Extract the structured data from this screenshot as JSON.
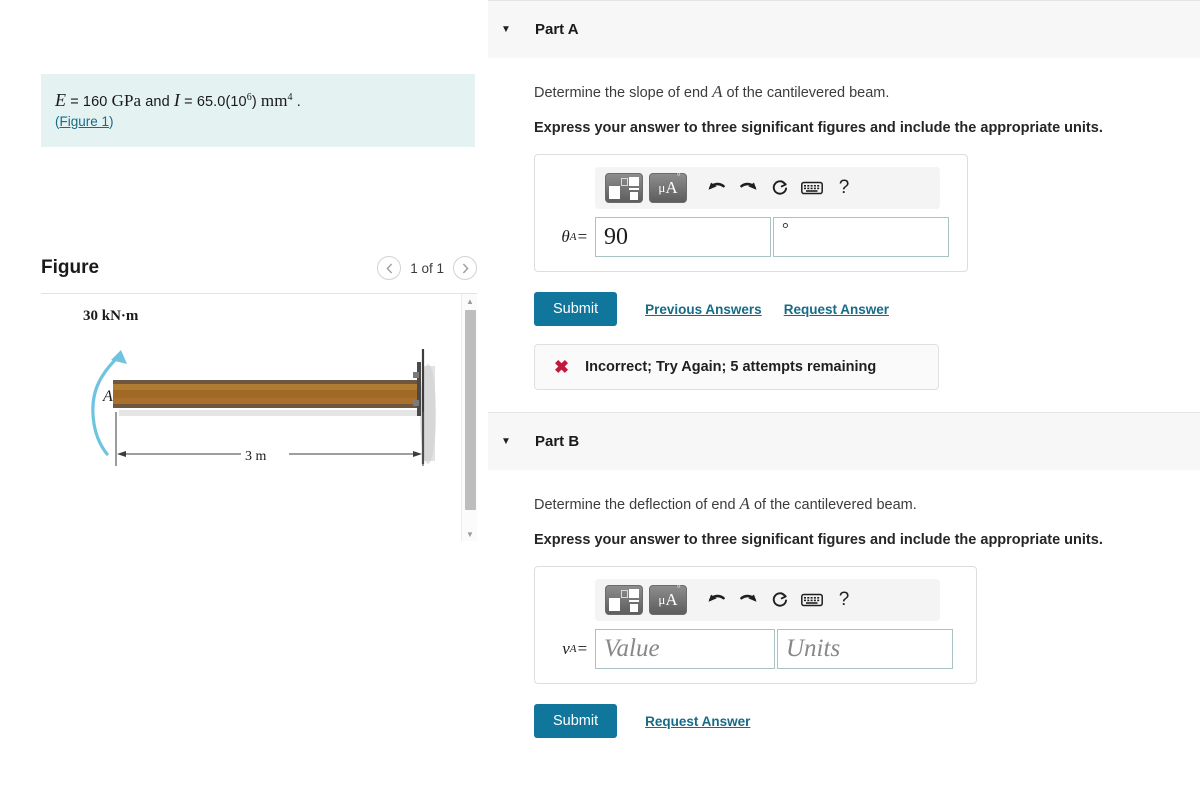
{
  "problem": {
    "statement_prefix": "E",
    "statement_eq1": " = 160  ",
    "statement_unit1": "GPa",
    "statement_and": " and ",
    "statement_I": "I",
    "statement_eq2": " = 65.0(10",
    "statement_exp": "6",
    "statement_close": ") ",
    "statement_unit2": "mm",
    "statement_exp2": "4",
    "statement_period": " .",
    "figure_link": "(Figure 1)",
    "figure_link_text": "Figure 1"
  },
  "figure_panel": {
    "title": "Figure",
    "prev_icon": "chevron-left-icon",
    "next_icon": "chevron-right-icon",
    "counter": "1 of 1",
    "diagram": {
      "moment_label": "30 kN·m",
      "point_label": "A",
      "dimension_label": "3 m",
      "beam_color": "#a8702a",
      "arrow_color": "#6ec3e0"
    }
  },
  "parts": [
    {
      "header": "Part A",
      "caret_icon": "caret-down-icon",
      "prompt_before": "Determine the slope of end ",
      "prompt_var": "A",
      "prompt_after": " of the cantilevered beam.",
      "instruction": "Express your answer to three significant figures and include the appropriate units.",
      "toolbar": {
        "template_icon": "math-template-icon",
        "units_icon": "units-mu-angstrom-icon",
        "units_label_mu": "μ",
        "units_label_a": "A",
        "undo_icon": "undo-icon",
        "redo_icon": "redo-icon",
        "reset_icon": "reset-icon",
        "keyboard_icon": "keyboard-icon",
        "help_icon": "help-icon",
        "help_label": "?"
      },
      "answer": {
        "symbol": "θ",
        "symbol_sub": "A",
        "equals": " =",
        "value": "90",
        "value_placeholder": "Value",
        "units_value": "°",
        "units_placeholder": "Units"
      },
      "submit_label": "Submit",
      "links": [
        "Previous Answers",
        "Request Answer"
      ],
      "feedback": {
        "icon": "error-x-icon",
        "text": "Incorrect; Try Again; 5 attempts remaining"
      }
    },
    {
      "header": "Part B",
      "caret_icon": "caret-down-icon",
      "prompt_before": "Determine the deflection of end ",
      "prompt_var": "A",
      "prompt_after": " of the cantilevered beam.",
      "instruction": "Express your answer to three significant figures and include the appropriate units.",
      "toolbar": {
        "template_icon": "math-template-icon",
        "units_icon": "units-mu-angstrom-icon",
        "units_label_mu": "μ",
        "units_label_a": "A",
        "undo_icon": "undo-icon",
        "redo_icon": "redo-icon",
        "reset_icon": "reset-icon",
        "keyboard_icon": "keyboard-icon",
        "help_icon": "help-icon",
        "help_label": "?"
      },
      "answer": {
        "symbol": "v",
        "symbol_sub": "A",
        "equals": " =",
        "value": "",
        "value_placeholder": "Value",
        "units_value": "",
        "units_placeholder": "Units"
      },
      "submit_label": "Submit",
      "links": [
        "Request Answer"
      ]
    }
  ],
  "colors": {
    "accent": "#11769b",
    "link": "#176b87",
    "info_bg": "#e4f2f2",
    "header_bg": "#f7f7f7",
    "error": "#c2183c"
  }
}
